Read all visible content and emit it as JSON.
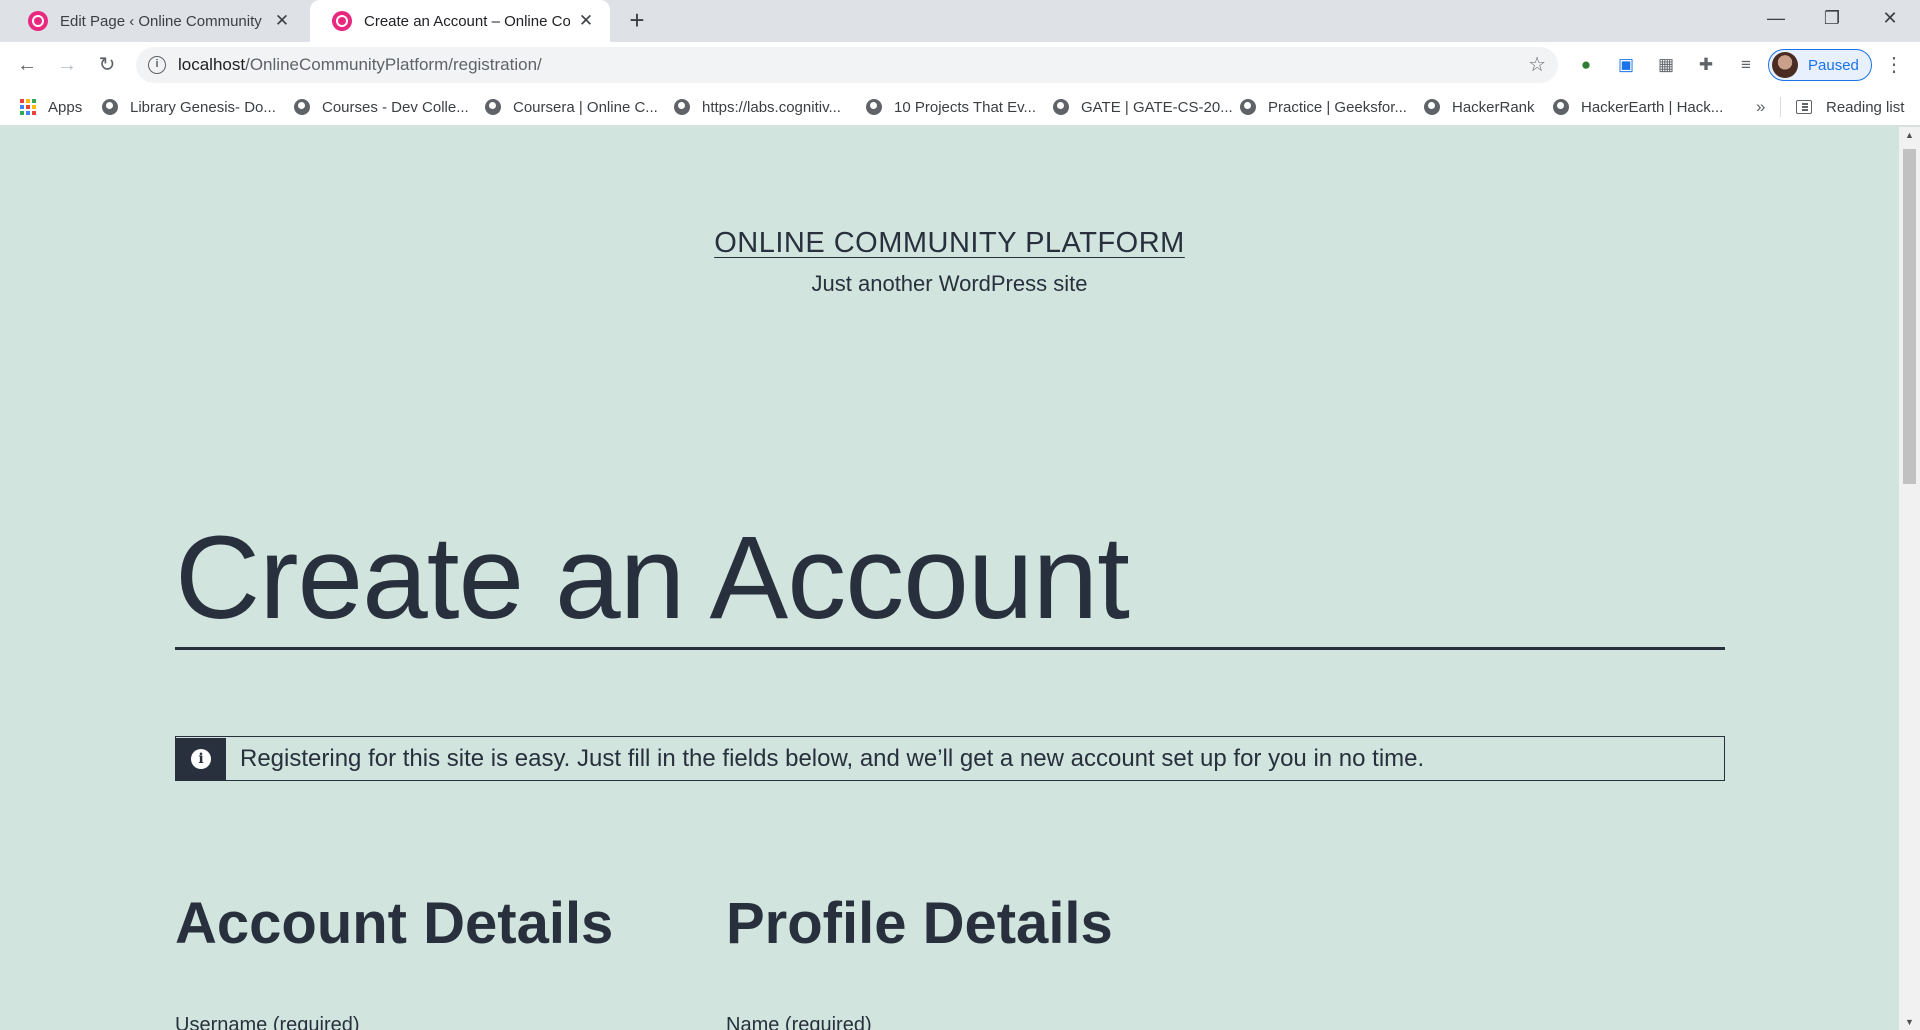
{
  "browser": {
    "tabs": [
      {
        "title": "Edit Page ‹ Online Community Platform — WordPress",
        "active": false
      },
      {
        "title": "Create an Account – Online Community Platform",
        "active": true
      }
    ],
    "new_tab_icon": "+",
    "window_controls": {
      "minimize": "—",
      "restore": "❐",
      "close": "✕"
    },
    "url_host": "localhost",
    "url_path": "/OnlineCommunityPlatform/registration/",
    "profile_status": "Paused",
    "bookmarks": [
      "Apps",
      "Library Genesis- Do...",
      "Courses - Dev Colle...",
      "Coursera | Online C...",
      "https://labs.cognitiv...",
      "10 Projects That Ev...",
      "GATE | GATE-CS-20...",
      "Practice | Geeksfor...",
      "HackerRank",
      "HackerEarth | Hack..."
    ],
    "bookmarks_overflow": "»",
    "reading_list": "Reading list",
    "accent_color": "#1a73e8"
  },
  "site": {
    "title": "ONLINE COMMUNITY PLATFORM",
    "description": "Just another WordPress site",
    "background_color": "#d1e4dd",
    "text_color": "#28303d"
  },
  "registration": {
    "heading": "Create an Account",
    "notice": "Registering for this site is easy. Just fill in the fields below, and we’ll get a new account set up for you in no time.",
    "account_section": "Account Details",
    "profile_section": "Profile Details",
    "account_first_label": "Username (required)",
    "profile_first_label": "Name (required)"
  }
}
